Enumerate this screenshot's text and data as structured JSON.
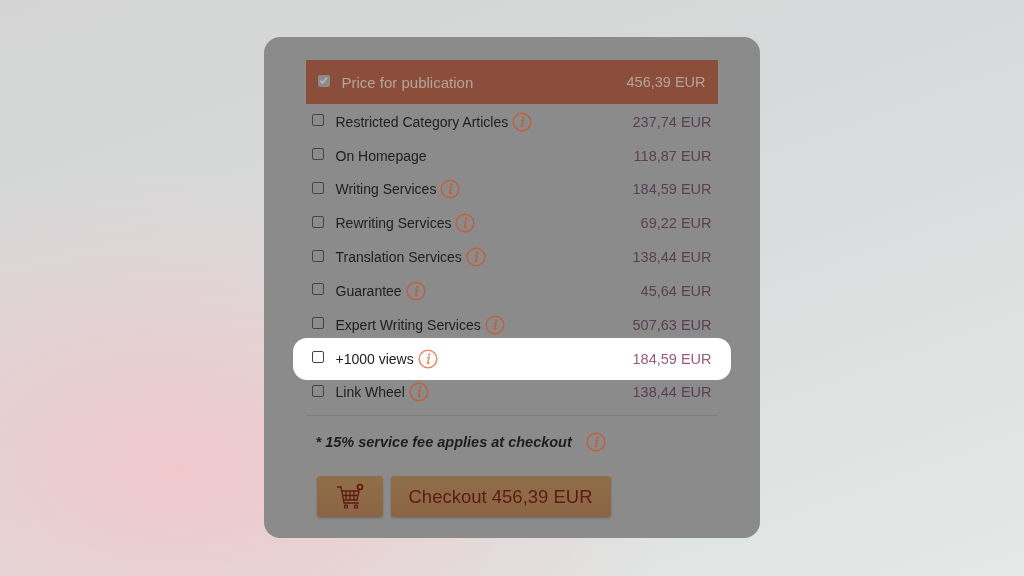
{
  "options": [
    {
      "kind": "header",
      "label": "Price for publication",
      "price": "456,39 EUR",
      "checked": true,
      "info": false,
      "highlighted": false
    },
    {
      "kind": "option",
      "label": "Restricted Category Articles",
      "price": "237,74 EUR",
      "checked": false,
      "info": true,
      "highlighted": false
    },
    {
      "kind": "option",
      "label": "On Homepage",
      "price": "118,87 EUR",
      "checked": false,
      "info": false,
      "highlighted": false
    },
    {
      "kind": "option",
      "label": "Writing Services",
      "price": "184,59 EUR",
      "checked": false,
      "info": true,
      "highlighted": false
    },
    {
      "kind": "option",
      "label": "Rewriting Services",
      "price": "69,22 EUR",
      "checked": false,
      "info": true,
      "highlighted": false
    },
    {
      "kind": "option",
      "label": "Translation Services",
      "price": "138,44 EUR",
      "checked": false,
      "info": true,
      "highlighted": false
    },
    {
      "kind": "option",
      "label": "Guarantee",
      "price": "45,64 EUR",
      "checked": false,
      "info": true,
      "highlighted": false
    },
    {
      "kind": "option",
      "label": "Expert Writing Services",
      "price": "507,63 EUR",
      "checked": false,
      "info": true,
      "highlighted": false
    },
    {
      "kind": "option",
      "label": "+1000 views",
      "price": "184,59 EUR",
      "checked": false,
      "info": true,
      "highlighted": true
    },
    {
      "kind": "option",
      "label": "Link Wheel",
      "price": "138,44 EUR",
      "checked": false,
      "info": true,
      "highlighted": false
    }
  ],
  "note": "* 15% service fee applies at checkout",
  "checkout_button": "Checkout 456,39 EUR"
}
